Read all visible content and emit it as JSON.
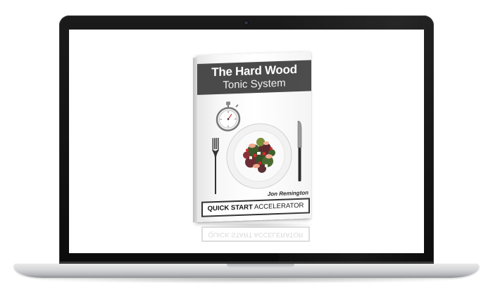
{
  "book": {
    "title_line1": "The Hard Wood",
    "title_line2": "Tonic System",
    "author": "Jon Remington",
    "badge_bold": "QUICK START",
    "badge_rest": " ACCELERATOR"
  },
  "reflection": {
    "text": "QUICK START ACCELERATOR"
  },
  "icons": [
    "laptop-icon",
    "stopwatch-icon",
    "fork-icon",
    "knife-icon",
    "salad-plate-icon"
  ],
  "colors": {
    "title_band": "#4a4a4a",
    "bezel": "#111111",
    "aluminum": "#d3d4d6"
  }
}
